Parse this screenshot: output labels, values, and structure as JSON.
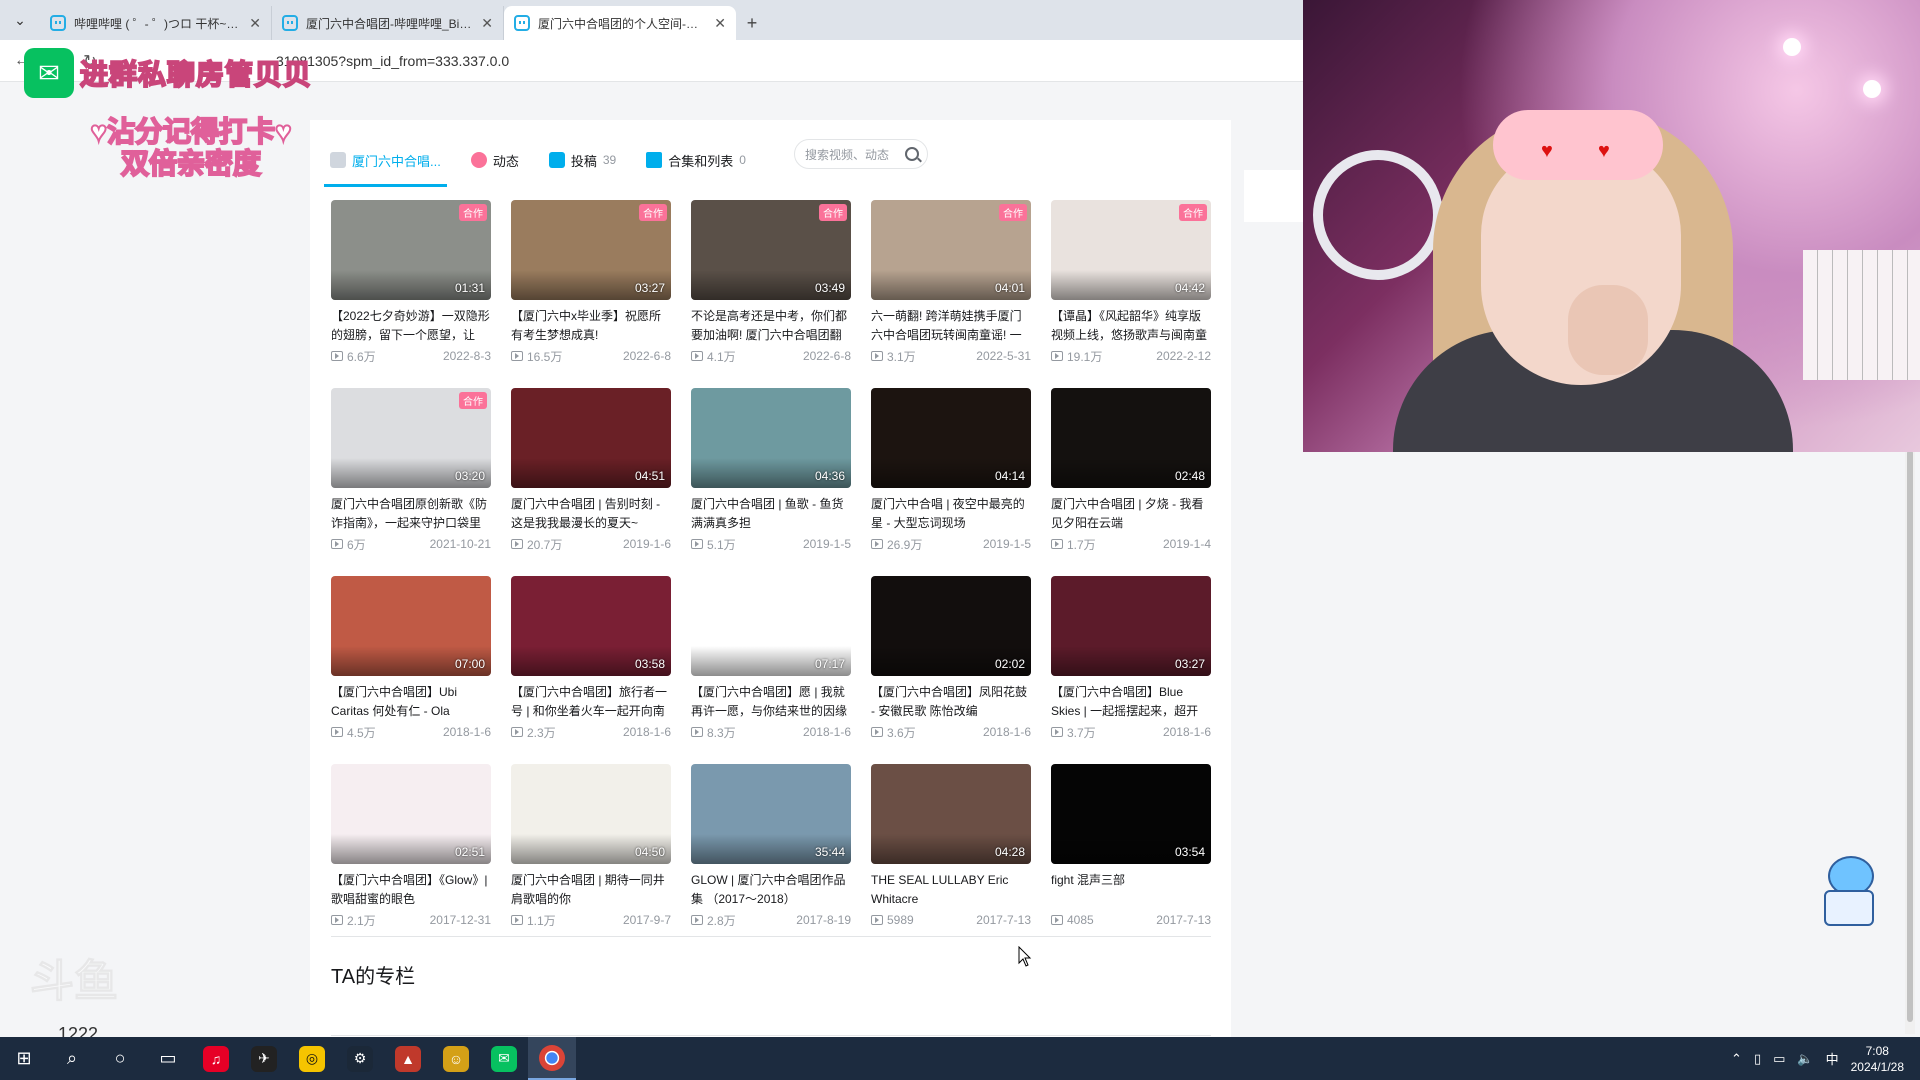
{
  "browser": {
    "tabs": [
      {
        "label": "哔哩哔哩 ( ゜- ゜)つロ 干杯~-bili",
        "active": false
      },
      {
        "label": "厦门六中合唱团-哔哩哔哩_Bilibili",
        "active": false
      },
      {
        "label": "厦门六中合唱团的个人空间-厦门",
        "active": true
      }
    ],
    "new_tab": "+",
    "url": "31081305?spm_id_from=333.337.0.0"
  },
  "overlay": {
    "wechat_text": "进群私聊房管贝贝",
    "checkin_text": "♥沾分记得打卡♥ 双倍亲密度"
  },
  "subnav": {
    "home": "厦门六中合唱...",
    "dynamic": "动态",
    "uploads": "投稿",
    "uploads_count": "39",
    "collections": "合集和列表",
    "collections_count": "0",
    "search_placeholder": "搜索视频、动态"
  },
  "videos": [
    {
      "title": "【2022七夕奇妙游】一双隐形的翅膀，留下一个愿望，让",
      "duration": "01:31",
      "plays": "6.6万",
      "date": "2022-8-3",
      "badge": "合作",
      "color": "#8c8f8a"
    },
    {
      "title": "【厦门六中x毕业季】祝愿所有考生梦想成真!",
      "duration": "03:27",
      "plays": "16.5万",
      "date": "2022-6-8",
      "badge": "合作",
      "color": "#9a7c5e"
    },
    {
      "title": "不论是高考还是中考，你们都要加油啊! 厦门六中合唱团翻",
      "duration": "03:49",
      "plays": "4.1万",
      "date": "2022-6-8",
      "badge": "合作",
      "color": "#5a5048"
    },
    {
      "title": "六一萌翻! 跨洋萌娃携手厦门六中合唱团玩转闽南童谣! 一",
      "duration": "04:01",
      "plays": "3.1万",
      "date": "2022-5-31",
      "badge": "合作",
      "color": "#b7a390"
    },
    {
      "title": "【谭晶】《风起韶华》纯享版视频上线，悠扬歌声与闽南童",
      "duration": "04:42",
      "plays": "19.1万",
      "date": "2022-2-12",
      "badge": "合作",
      "color": "#e9e2de"
    },
    {
      "title": "厦门六中合唱团原创新歌《防诈指南》，一起来守护口袋里",
      "duration": "03:20",
      "plays": "6万",
      "date": "2021-10-21",
      "badge": "合作",
      "color": "#dcdde0"
    },
    {
      "title": "厦门六中合唱团 | 告别时刻 - 这是我我最漫长的夏天~",
      "duration": "04:51",
      "plays": "20.7万",
      "date": "2019-1-6",
      "badge": "",
      "color": "#6a2026"
    },
    {
      "title": "厦门六中合唱团 | 鱼歌 - 鱼货满满真多担",
      "duration": "04:36",
      "plays": "5.1万",
      "date": "2019-1-5",
      "badge": "",
      "color": "#6e9aa0"
    },
    {
      "title": "厦门六中合唱 | 夜空中最亮的星 - 大型忘词现场",
      "duration": "04:14",
      "plays": "26.9万",
      "date": "2019-1-5",
      "badge": "",
      "color": "#1c1410"
    },
    {
      "title": "厦门六中合唱团 | 夕烧 - 我看见夕阳在云端",
      "duration": "02:48",
      "plays": "1.7万",
      "date": "2019-1-4",
      "badge": "",
      "color": "#14110f"
    },
    {
      "title": "【厦门六中合唱团】Ubi Caritas 何处有仁 - Ola",
      "duration": "07:00",
      "plays": "4.5万",
      "date": "2018-1-6",
      "badge": "",
      "color": "#c05a45"
    },
    {
      "title": "【厦门六中合唱团】旅行者一号 | 和你坐着火车一起开向南",
      "duration": "03:58",
      "plays": "2.3万",
      "date": "2018-1-6",
      "badge": "",
      "color": "#7a1f34"
    },
    {
      "title": "【厦门六中合唱团】愿 | 我就再许一愿，与你结来世的因缘",
      "duration": "07:17",
      "plays": "8.3万",
      "date": "2018-1-6",
      "badge": "",
      "color": "#ffffff"
    },
    {
      "title": "【厦门六中合唱团】凤阳花鼓 - 安徽民歌 陈怡改编",
      "duration": "02:02",
      "plays": "3.6万",
      "date": "2018-1-6",
      "badge": "",
      "color": "#120e0d"
    },
    {
      "title": "【厦门六中合唱团】Blue Skies | 一起摇摆起来，超开",
      "duration": "03:27",
      "plays": "3.7万",
      "date": "2018-1-6",
      "badge": "",
      "color": "#5c1b2a"
    },
    {
      "title": "【厦门六中合唱团】《Glow》| 歌唱甜蜜的眼色",
      "duration": "02:51",
      "plays": "2.1万",
      "date": "2017-12-31",
      "badge": "",
      "color": "#f6eef1"
    },
    {
      "title": "厦门六中合唱团 | 期待一同井肩歌唱的你",
      "duration": "04:50",
      "plays": "1.1万",
      "date": "2017-9-7",
      "badge": "",
      "color": "#f2f0ea"
    },
    {
      "title": "GLOW | 厦门六中合唱团作品集 （2017～2018）",
      "duration": "35:44",
      "plays": "2.8万",
      "date": "2017-8-19",
      "badge": "",
      "color": "#7a99ae"
    },
    {
      "title": "THE SEAL LULLABY Eric Whitacre",
      "duration": "04:28",
      "plays": "5989",
      "date": "2017-7-13",
      "badge": "",
      "color": "#6b4f45"
    },
    {
      "title": "fight 混声三部",
      "duration": "03:54",
      "plays": "4085",
      "date": "2017-7-13",
      "badge": "",
      "color": "#050505"
    }
  ],
  "column_title": "TA的专栏",
  "watermark": {
    "brand": "斗鱼",
    "room": "1222"
  },
  "taskbar": {
    "time": "7:08",
    "date": "2024/1/28",
    "ime": "中"
  },
  "icons": {
    "start": "windows-icon",
    "search": "search-icon",
    "cortana": "circle-icon",
    "taskview": "task-view-icon"
  }
}
